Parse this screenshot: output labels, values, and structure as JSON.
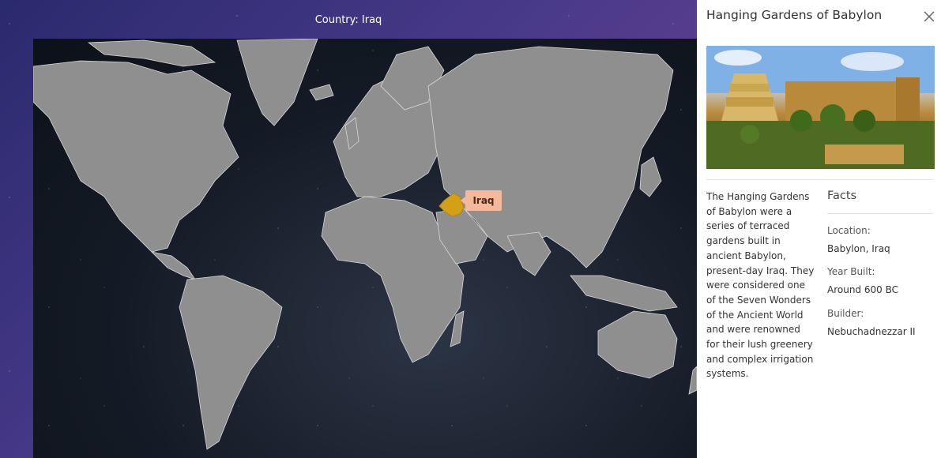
{
  "map": {
    "header": "Country: Iraq",
    "tooltip": "Iraq",
    "highlight_color": "#d4a017",
    "land_color": "#8f8f8f"
  },
  "panel": {
    "title": "Hanging Gardens of Babylon",
    "close_icon": "close-icon",
    "image_alt": "Hanging Gardens of Babylon illustration",
    "description": "The Hanging Gardens of Babylon were a series of terraced gardens built in ancient Babylon, present-day Iraq. They were considered one of the Seven Wonders of the Ancient World and were renowned for their lush greenery and complex irrigation systems.",
    "facts_title": "Facts",
    "facts": [
      {
        "label": "Location:",
        "value": "Babylon, Iraq"
      },
      {
        "label": "Year Built:",
        "value": "Around 600 BC"
      },
      {
        "label": "Builder:",
        "value": "Nebuchadnezzar II"
      }
    ]
  }
}
